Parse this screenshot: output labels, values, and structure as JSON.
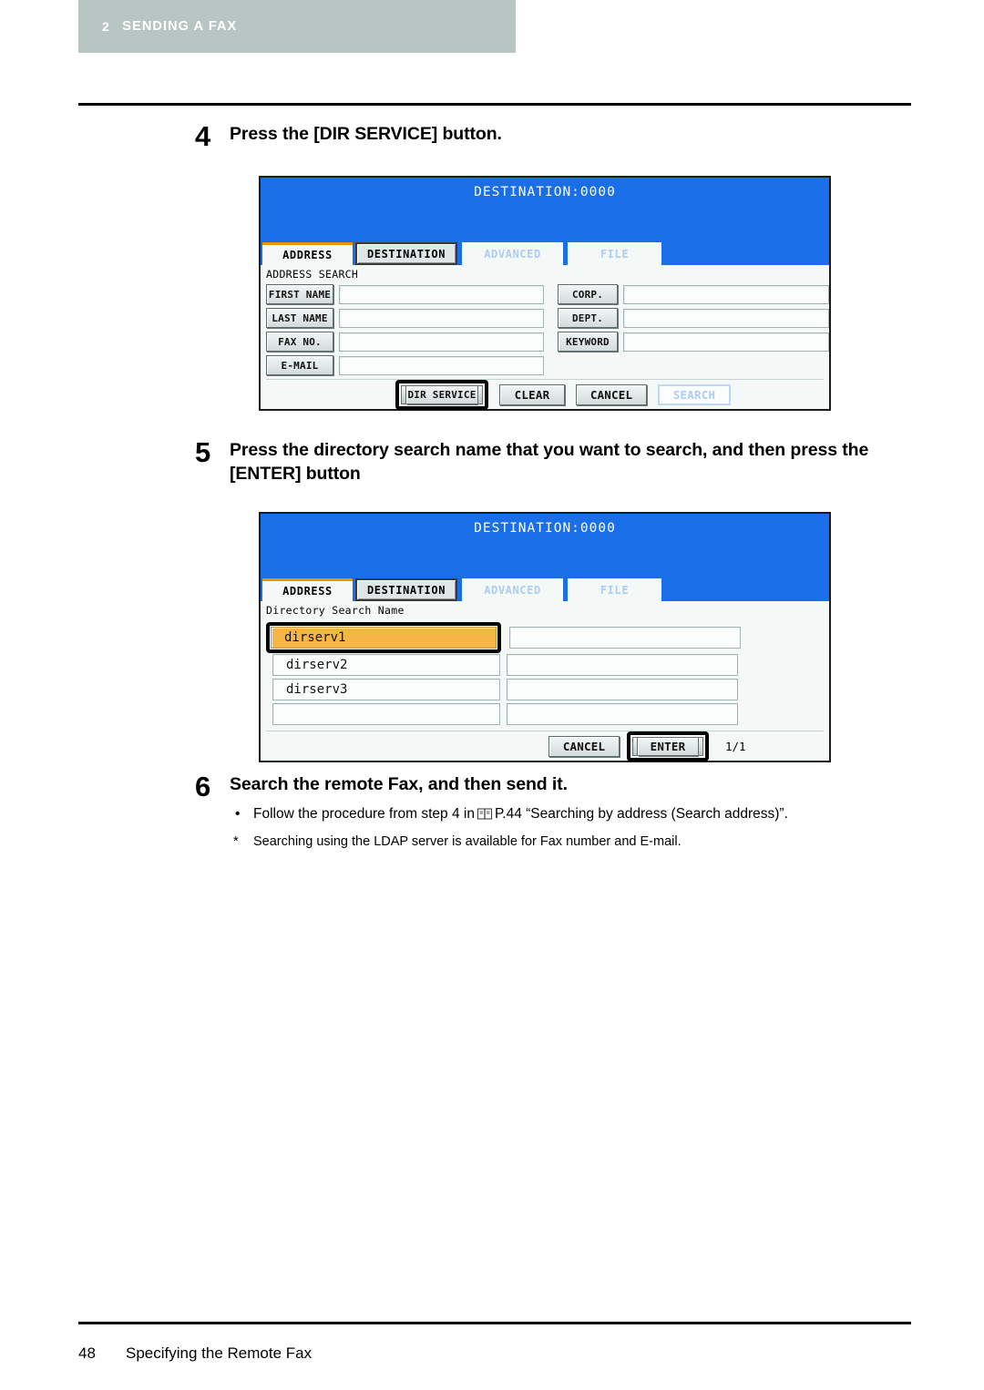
{
  "header": {
    "chapter_number": "2",
    "chapter_title": "SENDING A FAX"
  },
  "steps": [
    {
      "number": "4",
      "heading": "Press the [DIR SERVICE] button."
    },
    {
      "number": "5",
      "heading": "Press the directory search name that you want to search, and then press the [ENTER] button"
    },
    {
      "number": "6",
      "heading": "Search the remote Fax, and then send it.",
      "bullet_mark": "•",
      "bullet_text_before": "Follow the procedure from step 4 in",
      "bullet_icon": "book-icon",
      "bullet_text_after": "P.44 “Searching by address (Search address)”.",
      "note_mark": "*",
      "note_text": "Searching using the LDAP server is available for Fax number and E-mail."
    }
  ],
  "screen_address": {
    "destination_status": "DESTINATION:0000",
    "tabs": [
      {
        "label": "ADDRESS",
        "state": "active"
      },
      {
        "label": "DESTINATION",
        "state": "raised"
      },
      {
        "label": "ADVANCED",
        "state": "disabled"
      },
      {
        "label": "FILE",
        "state": "disabled"
      }
    ],
    "section_label": "ADDRESS SEARCH",
    "left_fields": [
      {
        "label": "FIRST NAME",
        "value": ""
      },
      {
        "label": "LAST NAME",
        "value": ""
      },
      {
        "label": "FAX NO.",
        "value": ""
      },
      {
        "label": "E-MAIL",
        "value": ""
      }
    ],
    "right_fields": [
      {
        "label": "CORP.",
        "value": ""
      },
      {
        "label": "DEPT.",
        "value": ""
      },
      {
        "label": "KEYWORD",
        "value": ""
      }
    ],
    "buttons": [
      {
        "label": "DIR SERVICE",
        "state": "highlighted"
      },
      {
        "label": "CLEAR",
        "state": "normal"
      },
      {
        "label": "CANCEL",
        "state": "normal"
      },
      {
        "label": "SEARCH",
        "state": "disabled"
      }
    ]
  },
  "screen_directory": {
    "destination_status": "DESTINATION:0000",
    "tabs": [
      {
        "label": "ADDRESS",
        "state": "active"
      },
      {
        "label": "DESTINATION",
        "state": "raised"
      },
      {
        "label": "ADVANCED",
        "state": "disabled"
      },
      {
        "label": "FILE",
        "state": "disabled"
      }
    ],
    "section_label": "Directory Search Name",
    "rows": [
      {
        "left": "dirserv1",
        "right": "",
        "selected": true
      },
      {
        "left": "dirserv2",
        "right": "",
        "selected": false
      },
      {
        "left": "dirserv3",
        "right": "",
        "selected": false
      },
      {
        "left": "",
        "right": "",
        "selected": false
      }
    ],
    "buttons": [
      {
        "label": "CANCEL",
        "state": "normal"
      },
      {
        "label": "ENTER",
        "state": "highlighted"
      }
    ],
    "page_indicator": "1/1"
  },
  "footer": {
    "page_number": "48",
    "section_title": "Specifying the Remote Fax"
  },
  "colors": {
    "chapter_bar": "#b9c5c3",
    "lcd_blue": "#1a6ee8",
    "tab_accent": "#f39200",
    "selected_row": "#f5b646",
    "disabled_text": "#aecdf2"
  }
}
